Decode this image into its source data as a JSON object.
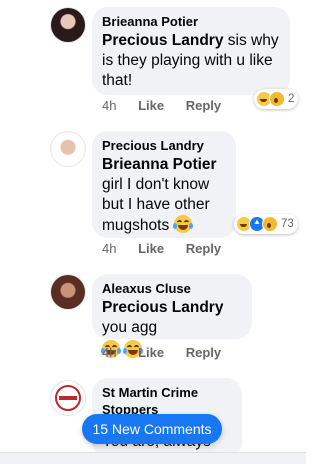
{
  "comments": [
    {
      "author": "Brieanna Potier",
      "mention": "Precious Landry",
      "text": " sis why is they playing with u like that!",
      "time": "4h",
      "like": "Like",
      "reply": "Reply",
      "reaction_count": "2",
      "reaction_icons": [
        "haha-icon",
        "wow-icon"
      ]
    },
    {
      "author": "Precious Landry",
      "mention": "Brieanna Potier",
      "text": " girl I don't know but I have other mugshots",
      "time": "4h",
      "like": "Like",
      "reply": "Reply",
      "reaction_count": "73",
      "reaction_icons": [
        "haha-icon",
        "like-icon",
        "wow-icon"
      ]
    },
    {
      "author": "Aleaxus Cluse",
      "mention": "Precious Landry",
      "text": " you agg",
      "time": "4h",
      "like": "Like",
      "reply": "Reply"
    },
    {
      "author": "St Martin Crime Stoppers",
      "text": "You are, always"
    }
  ],
  "new_comments_button": "15 New Comments",
  "colors": {
    "accent": "#1877f2",
    "bubble": "#f0f2f5",
    "meta": "#65676b"
  }
}
